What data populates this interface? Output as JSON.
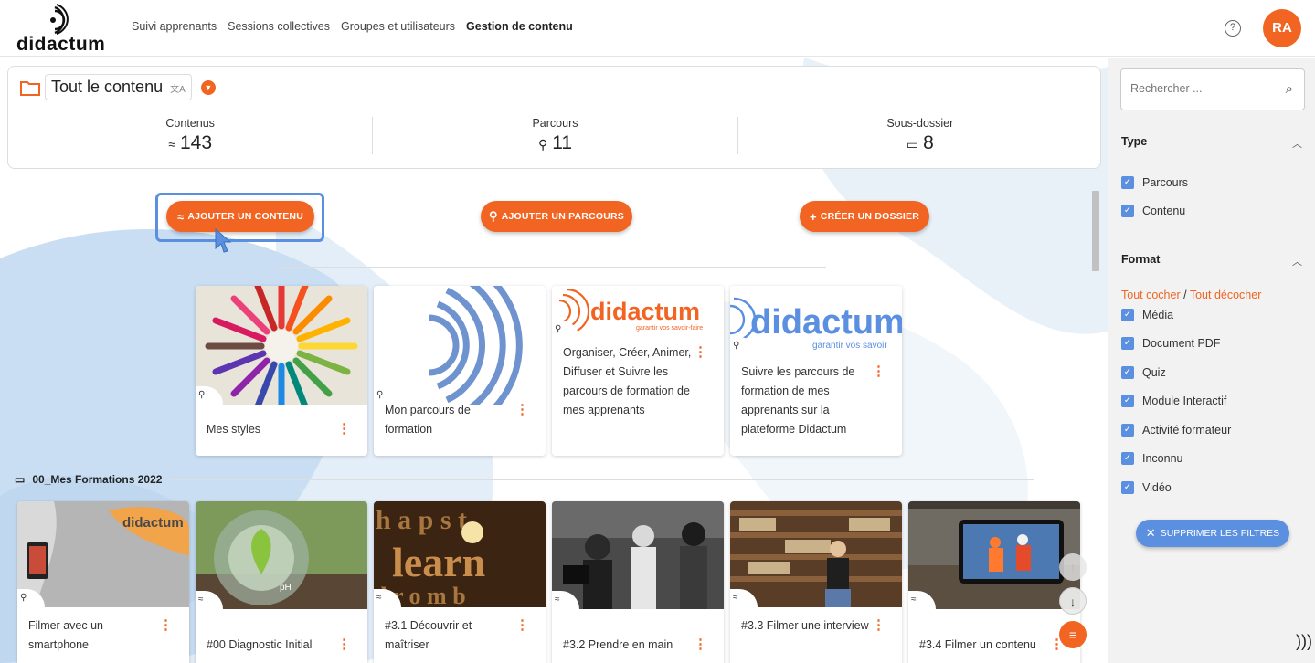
{
  "app": {
    "logo_text": "didactum",
    "avatar_initials": "RA",
    "help_icon": "help-circle-icon"
  },
  "nav": [
    "Suivi apprenants",
    "Sessions collectives",
    "Groupes et utilisateurs",
    "Gestion de contenu"
  ],
  "nav_active": "Gestion de contenu",
  "folder": {
    "title": "Tout le contenu",
    "translate_glyph": "文A"
  },
  "stats": [
    {
      "label": "Contenus",
      "value": "143",
      "icon": "content-icon"
    },
    {
      "label": "Parcours",
      "value": "11",
      "icon": "path-icon"
    },
    {
      "label": "Sous-dossier",
      "value": "8",
      "icon": "folder-icon"
    }
  ],
  "buttons": {
    "add_content": "AJOUTER UN CONTENU",
    "add_path": "AJOUTER UN PARCOURS",
    "create_folder": "CRÉER UN DOSSIER"
  },
  "path_cards": [
    {
      "title": "Mes styles"
    },
    {
      "title": "Mon parcours de formation"
    },
    {
      "title": "Organiser, Créer, Animer, Diffuser et Suivre les parcours de formation de mes apprenants",
      "brand_text": "didactum",
      "brand_tagline": "garantir vos savoir-faire"
    },
    {
      "title": "Suivre les parcours de formation de mes apprenants sur la plateforme Didactum",
      "brand_text": "didactu",
      "brand_tagline": "garantir vos savoir"
    }
  ],
  "section": {
    "title": "00_Mes Formations 2022"
  },
  "content_cards": [
    {
      "title": "Filmer avec un smartphone",
      "brand_text": "didactu"
    },
    {
      "title": "#00 Diagnostic Initial",
      "image_label": "pH"
    },
    {
      "title": "#3.1 Découvrir et maîtriser",
      "image_label": "learn"
    },
    {
      "title": "#3.2 Prendre en main"
    },
    {
      "title": "#3.3 Filmer une interview"
    },
    {
      "title": "#3.4 Filmer un contenu"
    }
  ],
  "sidebar": {
    "search_placeholder": "Rechercher ...",
    "type_header": "Type",
    "type_items": [
      "Parcours",
      "Contenu"
    ],
    "format_header": "Format",
    "check_all": "Tout cocher",
    "separator": "/",
    "uncheck_all": "Tout décocher",
    "format_items": [
      "Média",
      "Document PDF",
      "Quiz",
      "Module Interactif",
      "Activité formateur",
      "Inconnu",
      "Vidéo"
    ],
    "clear_filters": "SUPPRIMER LES FILTRES"
  },
  "colors": {
    "accent": "#f26422",
    "blue": "#5b8fe0"
  }
}
